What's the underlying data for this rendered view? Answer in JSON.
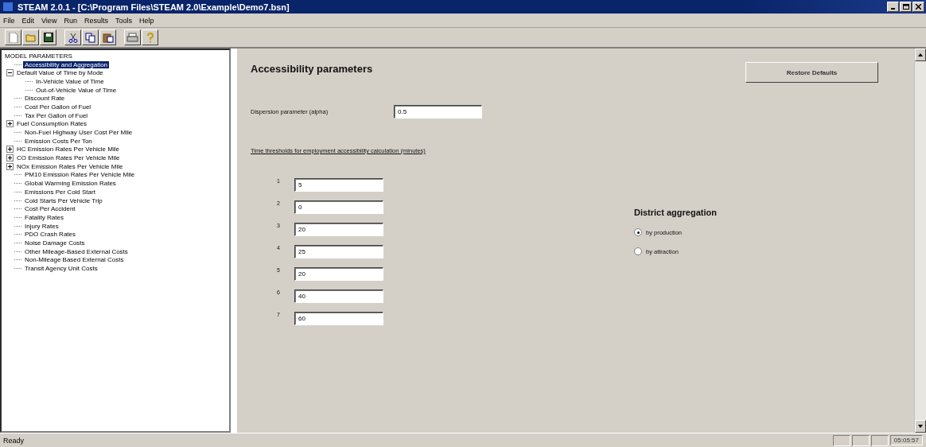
{
  "window": {
    "title": "STEAM 2.0.1  -  [C:\\Program Files\\STEAM 2.0\\Example\\Demo7.bsn]"
  },
  "menu": [
    "File",
    "Edit",
    "View",
    "Run",
    "Results",
    "Tools",
    "Help"
  ],
  "toolbar": [
    {
      "kind": "new"
    },
    {
      "kind": "open"
    },
    {
      "kind": "save"
    },
    {
      "kind": "sep"
    },
    {
      "kind": "cut"
    },
    {
      "kind": "copy"
    },
    {
      "kind": "paste"
    },
    {
      "kind": "sep"
    },
    {
      "kind": "print"
    },
    {
      "kind": "help"
    }
  ],
  "tree": {
    "root": "MODEL PARAMETERS",
    "items": [
      {
        "label": "Accessibility and Aggregation",
        "selected": true
      },
      {
        "label": "Default Value of Time by Mode",
        "selected": false,
        "expanded": true,
        "children": [
          {
            "label": "In-Vehicle Value of Time",
            "selected": false
          },
          {
            "label": "Out-of-Vehicle Value of Time",
            "selected": false
          }
        ]
      },
      {
        "label": "Discount Rate",
        "selected": false
      },
      {
        "label": "Cost Per Gallon of Fuel",
        "selected": false
      },
      {
        "label": "Tax Per Gallon of Fuel",
        "selected": false
      },
      {
        "label": "Fuel Consumption Rates",
        "selected": false,
        "expanded": false
      },
      {
        "label": "Non-Fuel Highway User Cost Per Mile",
        "selected": false
      },
      {
        "label": "Emission Costs Per Ton",
        "selected": false
      },
      {
        "label": "HC Emission Rates Per Vehicle Mile",
        "selected": false,
        "expanded": false
      },
      {
        "label": "CO Emission Rates Per Vehicle Mile",
        "selected": false,
        "expanded": false
      },
      {
        "label": "NOx Emission Rates Per Vehicle Mile",
        "selected": false,
        "expanded": false
      },
      {
        "label": "PM10 Emission Rates Per Vehicle Mile",
        "selected": false
      },
      {
        "label": "Global Warming Emission Rates",
        "selected": false
      },
      {
        "label": "Emissions Per Cold Start",
        "selected": false
      },
      {
        "label": "Cold Starts Per Vehicle Trip",
        "selected": false
      },
      {
        "label": "Cost Per Accident",
        "selected": false
      },
      {
        "label": "Fatality Rates",
        "selected": false
      },
      {
        "label": "Injury Rates",
        "selected": false
      },
      {
        "label": "PDO Crash Rates",
        "selected": false
      },
      {
        "label": "Noise Damage Costs",
        "selected": false
      },
      {
        "label": "Other Mileage-Based External Costs",
        "selected": false
      },
      {
        "label": "Non-Mileage Based External Costs",
        "selected": false
      },
      {
        "label": "Transit Agency Unit Costs",
        "selected": false
      }
    ]
  },
  "panel": {
    "heading": "Accessibility parameters",
    "restore_button": "Restore Defaults",
    "dispersion": {
      "label": "Dispersion parameter (alpha)",
      "value": "0.5"
    },
    "thresholds_heading": "Time thresholds for employment accessibility calculation (minutes)",
    "thresholds": [
      {
        "label": "1",
        "value": "5"
      },
      {
        "label": "2",
        "value": "0"
      },
      {
        "label": "3",
        "value": "20"
      },
      {
        "label": "4",
        "value": "25"
      },
      {
        "label": "5",
        "value": "20"
      },
      {
        "label": "6",
        "value": "40"
      },
      {
        "label": "7",
        "value": "60"
      }
    ],
    "district": {
      "heading": "District aggregation",
      "options": [
        {
          "label": "by production",
          "selected": true
        },
        {
          "label": "by attraction",
          "selected": false
        }
      ]
    }
  },
  "status_bar": {
    "text": "Ready",
    "clock": "05:05:57"
  }
}
